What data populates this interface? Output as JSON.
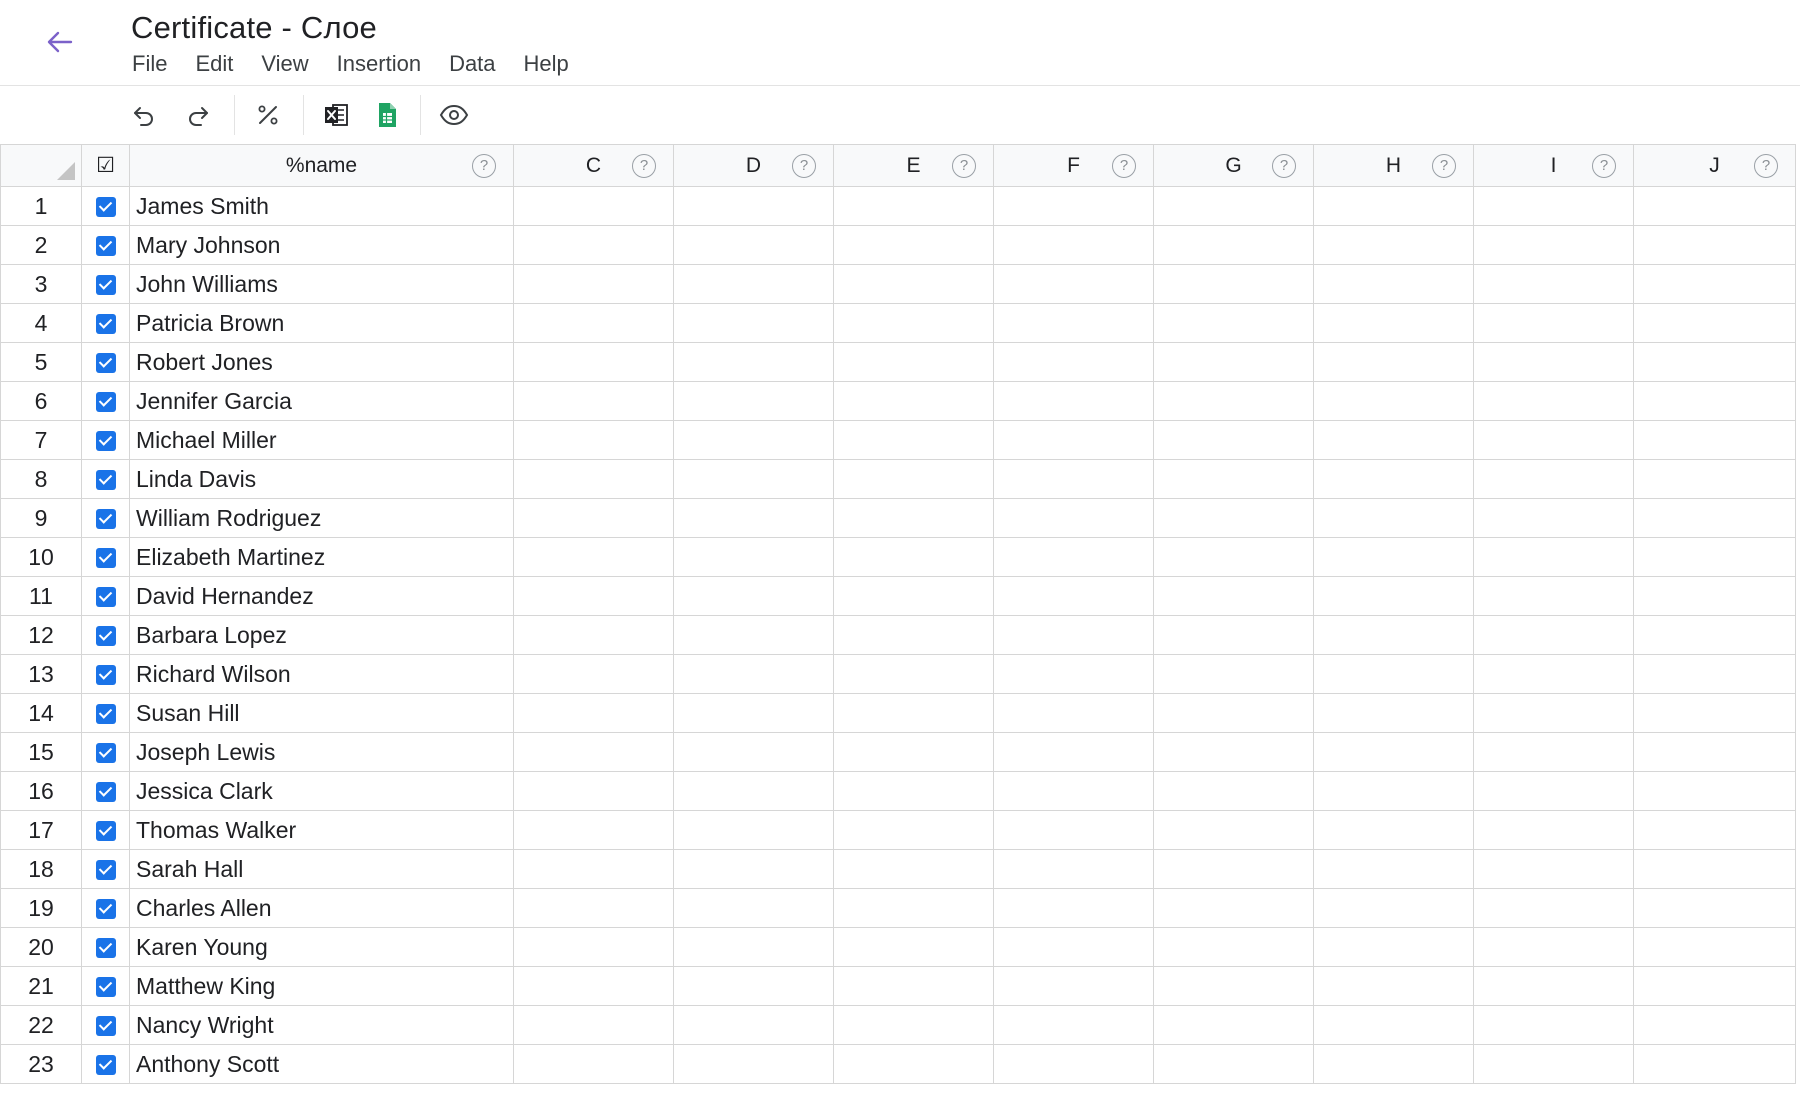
{
  "header": {
    "title": "Certificate - Слое",
    "back_icon": "arrow-left-icon",
    "accent_color": "#7b61c9"
  },
  "menu": [
    "File",
    "Edit",
    "View",
    "Insertion",
    "Data",
    "Help"
  ],
  "toolbar": {
    "buttons": [
      "undo-icon",
      "redo-icon",
      "percent-icon",
      "excel-icon",
      "google-sheets-icon",
      "eye-icon"
    ]
  },
  "sheet": {
    "check_header": "☑",
    "columns": [
      {
        "label": "%name",
        "help": "?"
      },
      {
        "label": "C",
        "help": "?"
      },
      {
        "label": "D",
        "help": "?"
      },
      {
        "label": "E",
        "help": "?"
      },
      {
        "label": "F",
        "help": "?"
      },
      {
        "label": "G",
        "help": "?"
      },
      {
        "label": "H",
        "help": "?"
      },
      {
        "label": "I",
        "help": "?"
      },
      {
        "label": "J",
        "help": "?"
      }
    ],
    "rows": [
      {
        "num": "1",
        "checked": true,
        "name": "James Smith"
      },
      {
        "num": "2",
        "checked": true,
        "name": "Mary Johnson"
      },
      {
        "num": "3",
        "checked": true,
        "name": "John Williams"
      },
      {
        "num": "4",
        "checked": true,
        "name": "Patricia Brown"
      },
      {
        "num": "5",
        "checked": true,
        "name": "Robert Jones"
      },
      {
        "num": "6",
        "checked": true,
        "name": "Jennifer Garcia"
      },
      {
        "num": "7",
        "checked": true,
        "name": "Michael Miller"
      },
      {
        "num": "8",
        "checked": true,
        "name": "Linda Davis"
      },
      {
        "num": "9",
        "checked": true,
        "name": "William Rodriguez"
      },
      {
        "num": "10",
        "checked": true,
        "name": "Elizabeth Martinez"
      },
      {
        "num": "11",
        "checked": true,
        "name": "David Hernandez"
      },
      {
        "num": "12",
        "checked": true,
        "name": "Barbara Lopez"
      },
      {
        "num": "13",
        "checked": true,
        "name": "Richard Wilson"
      },
      {
        "num": "14",
        "checked": true,
        "name": "Susan Hill"
      },
      {
        "num": "15",
        "checked": true,
        "name": "Joseph Lewis"
      },
      {
        "num": "16",
        "checked": true,
        "name": "Jessica Clark"
      },
      {
        "num": "17",
        "checked": true,
        "name": "Thomas Walker"
      },
      {
        "num": "18",
        "checked": true,
        "name": "Sarah Hall"
      },
      {
        "num": "19",
        "checked": true,
        "name": "Charles Allen"
      },
      {
        "num": "20",
        "checked": true,
        "name": "Karen Young"
      },
      {
        "num": "21",
        "checked": true,
        "name": "Matthew King"
      },
      {
        "num": "22",
        "checked": true,
        "name": "Nancy Wright"
      },
      {
        "num": "23",
        "checked": true,
        "name": "Anthony Scott"
      }
    ]
  }
}
